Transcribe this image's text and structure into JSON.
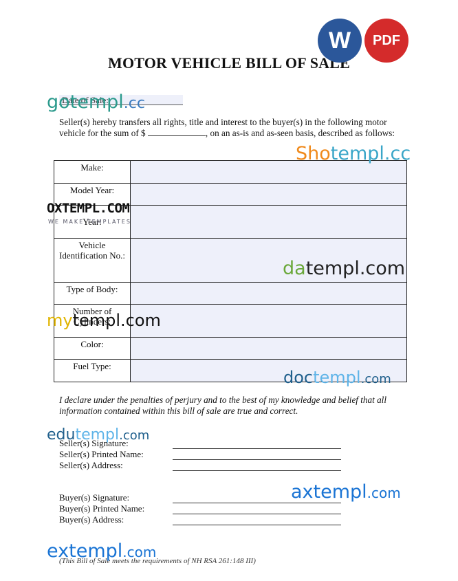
{
  "badges": {
    "word": "W",
    "pdf": "PDF"
  },
  "title": "MOTOR VEHICLE BILL OF SALE",
  "date_label": "Date of Sale:",
  "paragraph": {
    "part1": "Seller(s) hereby transfers all rights, title and interest to the buyer(s) in the following motor vehicle for the sum of $",
    "part2": ", on an as-is and as-seen basis, described as follows:"
  },
  "vehicle_fields": {
    "make": "Make:",
    "model_year": "Model Year:",
    "manufacture_year": "Year:",
    "vin": "Vehicle Identification No.:",
    "body": "Type of Body:",
    "cylinders": "Number of Cylinders:",
    "color": "Color:",
    "fuel": "Fuel Type:"
  },
  "declaration": "I declare under the penalties of perjury and to the best of my knowledge and belief that all information contained within this bill of sale are true and correct.",
  "seller": {
    "signature": "Seller(s) Signature:",
    "printed_name": "Seller(s) Printed Name:",
    "address": "Seller(s) Address:"
  },
  "buyer": {
    "signature": "Buyer(s) Signature:",
    "printed_name": "Buyer(s) Printed Name:",
    "address": "Buyer(s) Address:"
  },
  "footer": "(This Bill of Sale meets the requirements of NH RSA 261:148 III)",
  "watermarks": {
    "gotempl_a": "gotempl",
    "gotempl_b": ".cc",
    "shotempl_a": "Sho",
    "shotempl_b": "templ.cc",
    "oxtempl": "OXTEMPL.COM",
    "oxtempl_sub": "WE MAKE TEMPLATES",
    "datempl_a": "da",
    "datempl_b": "templ.com",
    "mytempl_a": "my",
    "mytempl_b": "templ.com",
    "doctempl_a": "doc",
    "doctempl_b": "templ",
    "doctempl_c": ".com",
    "edutempl_a": "edu",
    "edutempl_b": "templ",
    "edutempl_c": ".com",
    "axtempl_a": "ax",
    "axtempl_b": "templ",
    "axtempl_c": ".com",
    "extempl_a": "ex",
    "extempl_b": "templ",
    "extempl_c": ".com"
  }
}
